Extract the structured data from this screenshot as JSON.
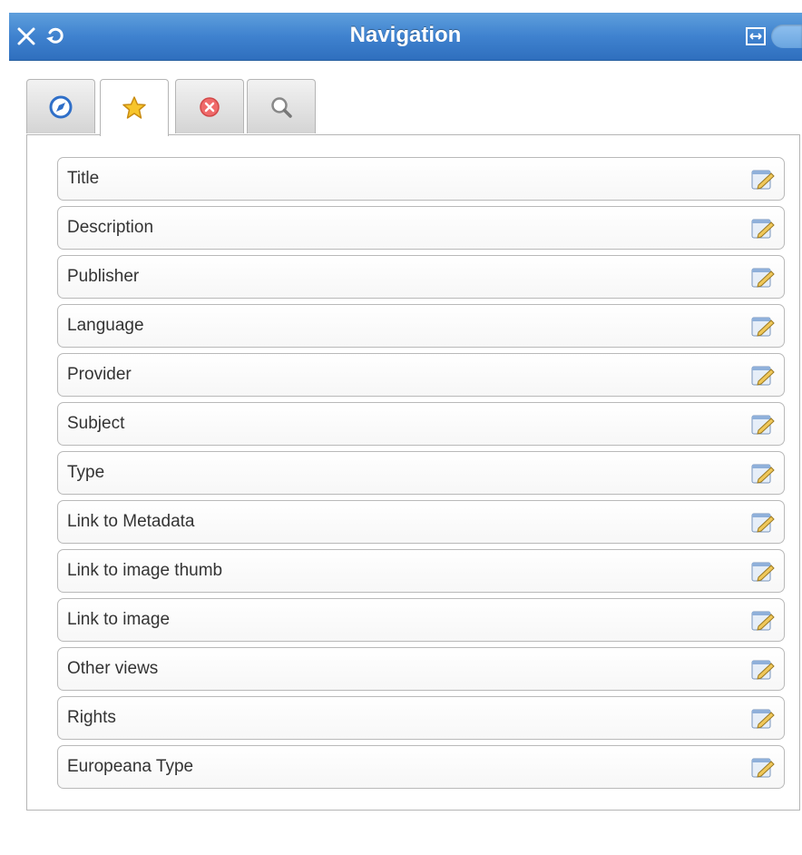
{
  "titlebar": {
    "title": "Navigation",
    "icons": {
      "close": "close-icon",
      "refresh": "refresh-icon",
      "expand": "expand-icon",
      "toggle": "toggle-switch"
    },
    "colors": {
      "accent": "#3f82cf"
    }
  },
  "tabs": [
    {
      "icon": "compass-icon"
    },
    {
      "icon": "star-icon",
      "active": true
    },
    {
      "icon": "remove-icon"
    },
    {
      "icon": "search-icon"
    }
  ],
  "fields": [
    {
      "label": "Title"
    },
    {
      "label": "Description"
    },
    {
      "label": "Publisher"
    },
    {
      "label": "Language"
    },
    {
      "label": "Provider"
    },
    {
      "label": "Subject"
    },
    {
      "label": "Type"
    },
    {
      "label": "Link to Metadata"
    },
    {
      "label": "Link to image thumb"
    },
    {
      "label": "Link to image"
    },
    {
      "label": "Other views"
    },
    {
      "label": "Rights"
    },
    {
      "label": "Europeana Type"
    }
  ]
}
